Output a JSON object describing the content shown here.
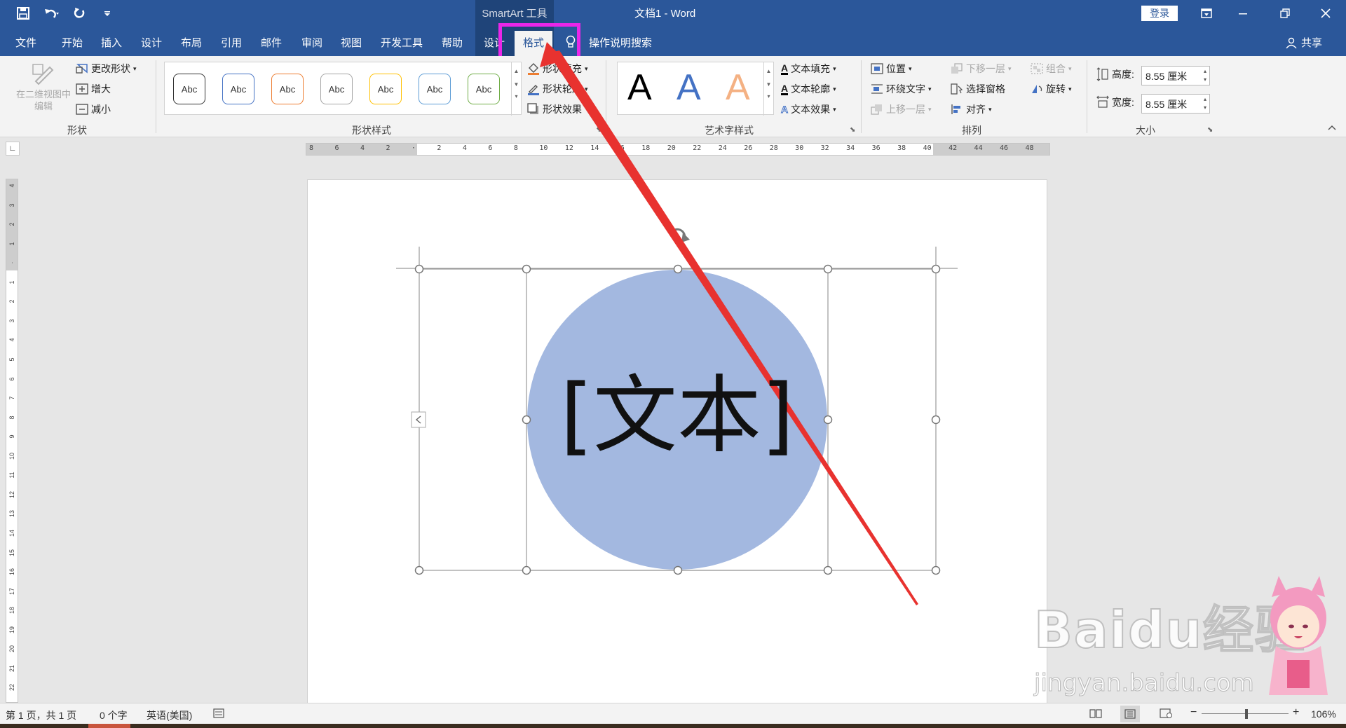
{
  "titlebar": {
    "context_title": "SmartArt 工具",
    "doc_title": "文档1  -  Word",
    "login_label": "登录",
    "qat_icons": [
      "save-icon",
      "undo-icon",
      "redo-icon",
      "customize-qat-icon"
    ],
    "window_icons": [
      "ribbon-display-icon",
      "minimize-icon",
      "restore-icon",
      "close-icon"
    ]
  },
  "tabs": {
    "file": "文件",
    "home": "开始",
    "insert": "插入",
    "design": "设计",
    "layout": "布局",
    "references": "引用",
    "mailings": "邮件",
    "review": "审阅",
    "view": "视图",
    "developer": "开发工具",
    "help": "帮助",
    "smartart_design": "设计",
    "format": "格式",
    "tell_me": "操作说明搜索",
    "share": "共享"
  },
  "ribbon": {
    "shapes": {
      "edit_2d": "在二维视图中编辑",
      "change_shape": "更改形状",
      "larger": "增大",
      "smaller": "减小",
      "group_label": "形状"
    },
    "shape_styles": {
      "gallery": [
        {
          "label": "Abc",
          "color": "#333333"
        },
        {
          "label": "Abc",
          "color": "#4472c4"
        },
        {
          "label": "Abc",
          "color": "#ed7d31"
        },
        {
          "label": "Abc",
          "color": "#a5a5a5"
        },
        {
          "label": "Abc",
          "color": "#ffc000"
        },
        {
          "label": "Abc",
          "color": "#5b9bd5"
        },
        {
          "label": "Abc",
          "color": "#70ad47"
        }
      ],
      "fill": "形状填充",
      "outline": "形状轮廓",
      "effects": "形状效果",
      "group_label": "形状样式"
    },
    "wordart": {
      "samples": [
        {
          "label": "A",
          "color": "#000000"
        },
        {
          "label": "A",
          "color": "#4472c4"
        },
        {
          "label": "A",
          "color": "#f4b183"
        }
      ],
      "text_fill": "文本填充",
      "text_outline": "文本轮廓",
      "text_effects": "文本效果",
      "group_label": "艺术字样式"
    },
    "arrange": {
      "position": "位置",
      "wrap_text": "环绕文字",
      "bring_forward": "上移一层",
      "send_backward": "下移一层",
      "selection_pane": "选择窗格",
      "align": "对齐",
      "group": "组合",
      "rotate": "旋转",
      "group_label": "排列"
    },
    "size": {
      "height_label": "高度:",
      "height_value": "8.55 厘米",
      "width_label": "宽度:",
      "width_value": "8.55 厘米",
      "group_label": "大小"
    }
  },
  "ruler": {
    "h_ticks": [
      "8",
      "6",
      "4",
      "2",
      "",
      "2",
      "4",
      "6",
      "8",
      "10",
      "12",
      "14",
      "16",
      "18",
      "20",
      "22",
      "24",
      "26",
      "28",
      "30",
      "32",
      "34",
      "36",
      "38",
      "40",
      "42",
      "44",
      "46",
      "48"
    ],
    "v_ticks": [
      "4",
      "3",
      "2",
      "1",
      "",
      "1",
      "2",
      "3",
      "4",
      "5",
      "6",
      "7",
      "8",
      "9",
      "10",
      "11",
      "12",
      "13",
      "14",
      "15",
      "16",
      "17",
      "18",
      "19",
      "20",
      "21",
      "22"
    ]
  },
  "canvas": {
    "shape_text": "[文本]",
    "circle_color": "#a3b8e0",
    "annotation_color": "#e8322f",
    "highlight_color": "#ea26e8"
  },
  "statusbar": {
    "page": "第 1 页，共 1 页",
    "words": "0 个字",
    "language": "英语(美国)",
    "zoom": "106%"
  },
  "watermark": {
    "brand": "Baidu经验",
    "url": "jingyan.baidu.com"
  }
}
